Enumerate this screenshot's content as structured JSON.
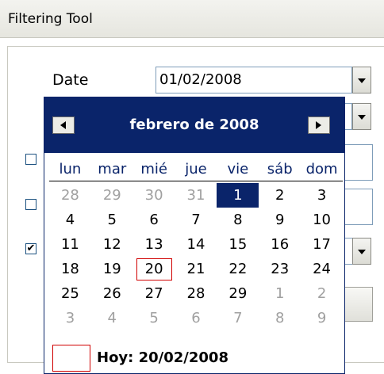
{
  "panel": {
    "title": "Filtering Tool"
  },
  "form": {
    "date_label": "Date",
    "date_value": "01/02/2008",
    "checkbox3_checked_glyph": "✔"
  },
  "calendar": {
    "month_title": "febrero de 2008",
    "prev_icon": "left-arrow-icon",
    "next_icon": "right-arrow-icon",
    "weekdays": [
      "lun",
      "mar",
      "mié",
      "jue",
      "vie",
      "sáb",
      "dom"
    ],
    "weeks": [
      [
        "28",
        "29",
        "30",
        "31",
        "1",
        "2",
        "3"
      ],
      [
        "4",
        "5",
        "6",
        "7",
        "8",
        "9",
        "10"
      ],
      [
        "11",
        "12",
        "13",
        "14",
        "15",
        "16",
        "17"
      ],
      [
        "18",
        "19",
        "20",
        "21",
        "22",
        "23",
        "24"
      ],
      [
        "25",
        "26",
        "27",
        "28",
        "29",
        "1",
        "2"
      ],
      [
        "3",
        "4",
        "5",
        "6",
        "7",
        "8",
        "9"
      ]
    ],
    "other_month_cells": [
      "0-0",
      "0-1",
      "0-2",
      "0-3",
      "4-5",
      "4-6",
      "5-0",
      "5-1",
      "5-2",
      "5-3",
      "5-4",
      "5-5",
      "5-6"
    ],
    "selected_cell": "0-4",
    "today_cell": "3-2",
    "today_text": "Hoy: 20/02/2008",
    "colors": {
      "header_bg": "#0a246a",
      "weekday_text": "#0a246a",
      "other_month_text": "#a0a0a0",
      "today_outline": "#d00000"
    }
  }
}
